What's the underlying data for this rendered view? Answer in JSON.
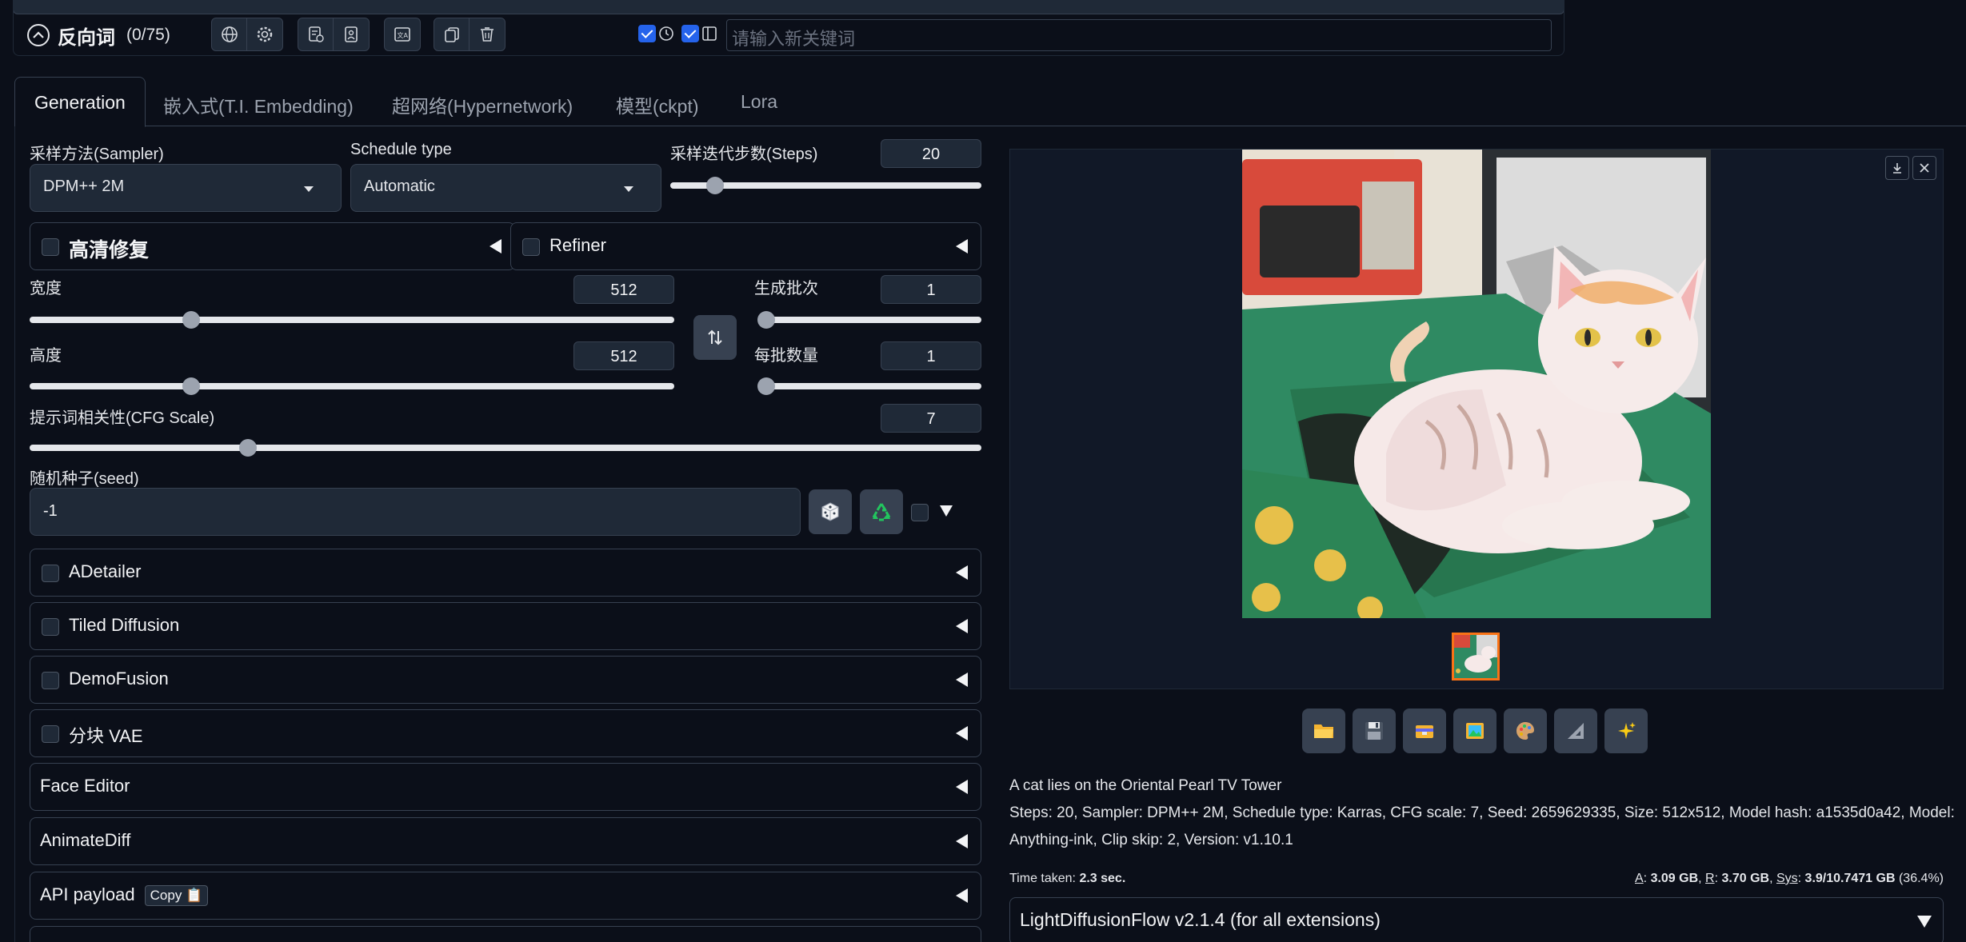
{
  "negative_prompt": {
    "title": "反向词",
    "count": "(0/75)",
    "tag_input_placeholder": "请输入新关键词"
  },
  "tabs": [
    {
      "label": "Generation",
      "active": true
    },
    {
      "label": "嵌入式(T.I. Embedding)"
    },
    {
      "label": "超网络(Hypernetwork)"
    },
    {
      "label": "模型(ckpt)"
    },
    {
      "label": "Lora"
    }
  ],
  "settings": {
    "sampler": {
      "label": "采样方法(Sampler)",
      "value": "DPM++ 2M"
    },
    "schedule": {
      "label": "Schedule type",
      "value": "Automatic"
    },
    "steps": {
      "label": "采样迭代步数(Steps)",
      "value": "20",
      "level": 0.13
    },
    "hires": {
      "label": "高清修复"
    },
    "refiner": {
      "label": "Refiner"
    },
    "width": {
      "label": "宽度",
      "value": "512",
      "level": 0.2353
    },
    "height": {
      "label": "高度",
      "value": "512",
      "level": 0.2353
    },
    "batch_count": {
      "label": "生成批次",
      "value": "1",
      "level": 0.0
    },
    "batch_size": {
      "label": "每批数量",
      "value": "1",
      "level": 0.0
    },
    "cfg": {
      "label": "提示词相关性(CFG Scale)",
      "value": "7",
      "level": 0.2143
    },
    "seed": {
      "label": "随机种子(seed)",
      "value": "-1"
    }
  },
  "accordions": [
    {
      "label": "ADetailer",
      "checkbox": true
    },
    {
      "label": "Tiled Diffusion",
      "checkbox": true
    },
    {
      "label": "DemoFusion",
      "checkbox": true
    },
    {
      "label": "分块 VAE",
      "checkbox": true
    },
    {
      "label": "Face Editor",
      "checkbox": false
    },
    {
      "label": "AnimateDiff",
      "checkbox": false
    },
    {
      "label": "API payload",
      "checkbox": false,
      "button": "Copy 📋"
    }
  ],
  "output": {
    "prompt": "A cat lies on the Oriental Pearl TV Tower",
    "params": "Steps: 20, Sampler: DPM++ 2M, Schedule type: Karras, CFG scale: 7, Seed: 2659629335, Size: 512x512, Model hash: a1535d0a42, Model: Anything-ink, Clip skip: 2, Version: v1.10.1",
    "time_label": "Time taken: ",
    "time_value": "2.3 sec.",
    "mem_a_label": "A",
    "mem_a_value": "3.09 GB",
    "mem_r_label": "R",
    "mem_r_value": "3.70 GB",
    "mem_sys_label": "Sys",
    "mem_sys_value": "3.9/10.7471 GB",
    "mem_sys_pct": "(36.4%)",
    "lightdiffusionflow": "LightDiffusionFlow v2.1.4 (for all extensions)"
  },
  "icons": {
    "action_buttons": [
      "folder-icon",
      "save-icon",
      "zip-icon",
      "send-to-img2img-icon",
      "send-to-inpaint-icon",
      "send-to-extras-icon",
      "sparkle-icon"
    ]
  }
}
